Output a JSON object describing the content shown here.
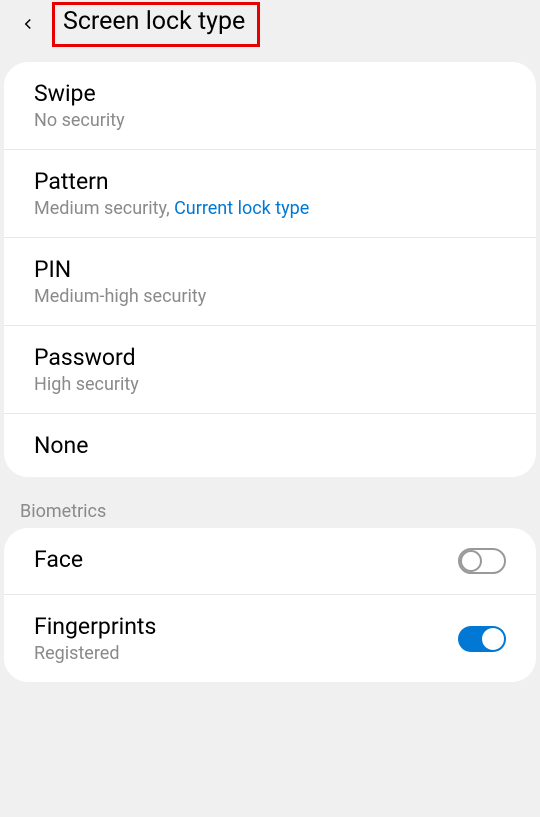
{
  "header": {
    "title": "Screen lock type"
  },
  "options": [
    {
      "title": "Swipe",
      "sub": "No security"
    },
    {
      "title": "Pattern",
      "sub_prefix": "Medium security, ",
      "sub_link": "Current lock type"
    },
    {
      "title": "PIN",
      "sub": "Medium-high security"
    },
    {
      "title": "Password",
      "sub": "High security"
    },
    {
      "title": "None"
    }
  ],
  "biometrics": {
    "label": "Biometrics",
    "items": [
      {
        "title": "Face",
        "enabled": false
      },
      {
        "title": "Fingerprints",
        "sub": "Registered",
        "enabled": true
      }
    ]
  }
}
